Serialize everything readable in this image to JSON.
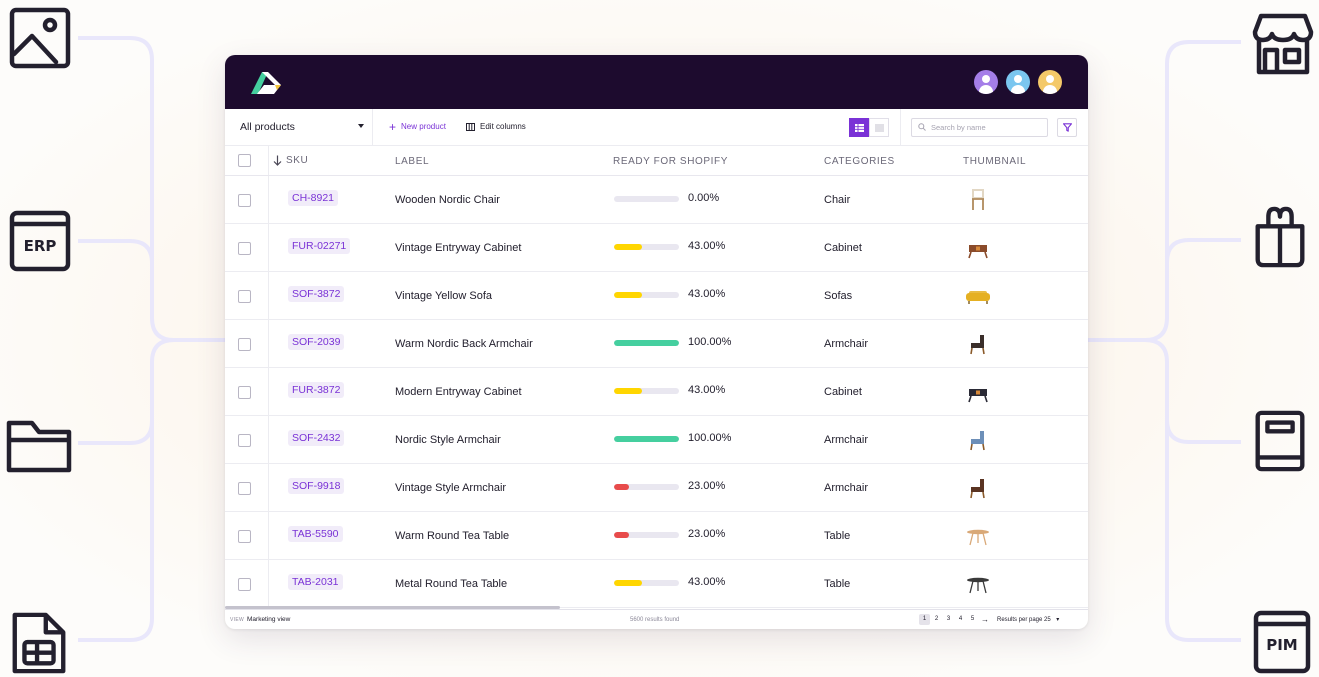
{
  "colors": {
    "brand": "#7a32d6",
    "topbar": "#1d0b2e",
    "bar_track": "#e9e7f0",
    "bar_yellow": "#ffd600",
    "bar_green": "#45cf9f",
    "bar_red": "#e84b4b",
    "connector": "#e9e7fb"
  },
  "side_icons": {
    "left": [
      {
        "name": "image-icon"
      },
      {
        "name": "erp-icon",
        "text": "ERP"
      },
      {
        "name": "folder-icon"
      },
      {
        "name": "spreadsheet-file-icon"
      }
    ],
    "right": [
      {
        "name": "storefront-icon"
      },
      {
        "name": "shopping-bag-icon"
      },
      {
        "name": "catalog-book-icon"
      },
      {
        "name": "pim-icon",
        "text": "PIM"
      }
    ]
  },
  "toolbar": {
    "selector_value": "All products",
    "new_product_label": "New product",
    "edit_columns_label": "Edit columns",
    "search_placeholder": "Search by name"
  },
  "columns": {
    "sku": "SKU",
    "label": "LABEL",
    "ready": "READY FOR SHOPIFY",
    "categories": "CATEGORIES",
    "thumbnail": "THUMBNAIL"
  },
  "rows": [
    {
      "sku": "CH-8921",
      "label": "Wooden Nordic Chair",
      "progress": 0,
      "progress_text": "0.00%",
      "bar_color": "#e9e7f0",
      "category": "Chair",
      "thumbnail_icon": "white-chair-icon",
      "thumb_color": "#e2d7c4"
    },
    {
      "sku": "FUR-02271",
      "label": "Vintage Entryway Cabinet",
      "progress": 0.43,
      "progress_text": "43.00%",
      "bar_color": "#ffd600",
      "category": "Cabinet",
      "thumbnail_icon": "cabinet-icon",
      "thumb_color": "#8a4b2a"
    },
    {
      "sku": "SOF-3872",
      "label": "Vintage Yellow Sofa",
      "progress": 0.43,
      "progress_text": "43.00%",
      "bar_color": "#ffd600",
      "category": "Sofas",
      "thumbnail_icon": "sofa-icon",
      "thumb_color": "#e5b022"
    },
    {
      "sku": "SOF-2039",
      "label": "Warm Nordic Back Armchair",
      "progress": 1,
      "progress_text": "100.00%",
      "bar_color": "#45cf9f",
      "category": "Armchair",
      "thumbnail_icon": "armchair-icon",
      "thumb_color": "#3a2e2a"
    },
    {
      "sku": "FUR-3872",
      "label": "Modern Entryway Cabinet",
      "progress": 0.43,
      "progress_text": "43.00%",
      "bar_color": "#ffd600",
      "category": "Cabinet",
      "thumbnail_icon": "cabinet-icon",
      "thumb_color": "#2a2a36"
    },
    {
      "sku": "SOF-2432",
      "label": "Nordic Style Armchair",
      "progress": 1,
      "progress_text": "100.00%",
      "bar_color": "#45cf9f",
      "category": "Armchair",
      "thumbnail_icon": "armchair-icon",
      "thumb_color": "#6d8fb8"
    },
    {
      "sku": "SOF-9918",
      "label": "Vintage Style Armchair",
      "progress": 0.23,
      "progress_text": "23.00%",
      "bar_color": "#e84b4b",
      "category": "Armchair",
      "thumbnail_icon": "armchair-icon",
      "thumb_color": "#5a3422"
    },
    {
      "sku": "TAB-5590",
      "label": "Warm Round Tea Table",
      "progress": 0.23,
      "progress_text": "23.00%",
      "bar_color": "#e84b4b",
      "category": "Table",
      "thumbnail_icon": "tea-table-icon",
      "thumb_color": "#d9a978"
    },
    {
      "sku": "TAB-2031",
      "label": "Metal Round Tea Table",
      "progress": 0.43,
      "progress_text": "43.00%",
      "bar_color": "#ffd600",
      "category": "Table",
      "thumbnail_icon": "tea-table-icon",
      "thumb_color": "#3a3a3a"
    }
  ],
  "footer": {
    "view_label": "VIEW",
    "view_name": "Marketing view",
    "results_text": "5600 results found",
    "pages": [
      "1",
      "2",
      "3",
      "4",
      "5"
    ],
    "current_page": "1",
    "per_page_text": "Results per page 25"
  },
  "avatars": [
    {
      "name": "avatar-purple",
      "color": "#a57ee8"
    },
    {
      "name": "avatar-blue",
      "color": "#7bc6ef"
    },
    {
      "name": "avatar-yellow",
      "color": "#f4c969"
    }
  ]
}
